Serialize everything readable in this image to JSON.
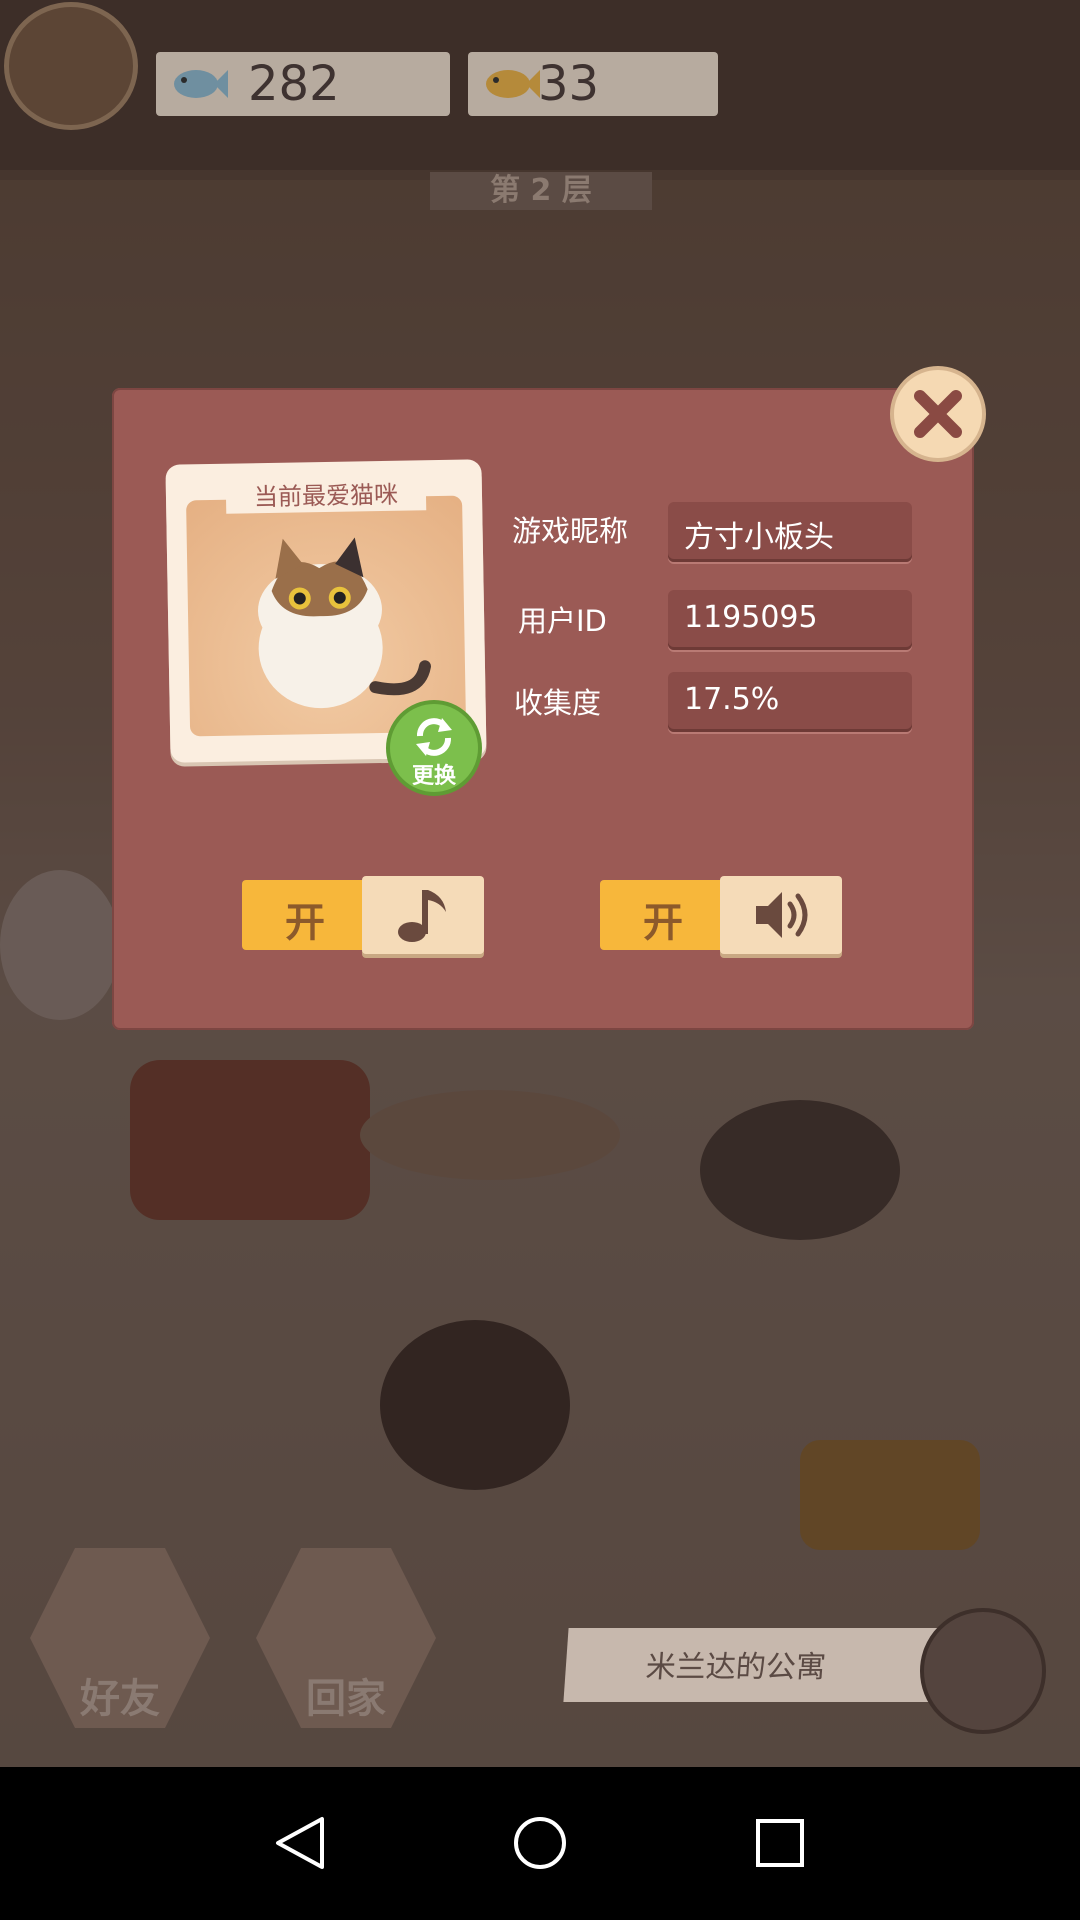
{
  "top_bar": {
    "fish_blue_count": "282",
    "fish_gold_count": "33",
    "floor_label": "第 2 层"
  },
  "profile_dialog": {
    "card_title": "当前最爱猫咪",
    "swap_label": "更换",
    "fields": [
      {
        "label": "游戏昵称",
        "value": "方寸小板头"
      },
      {
        "label": "用户ID",
        "value": "1195095"
      },
      {
        "label": "收集度",
        "value": "17.5%"
      }
    ],
    "music_toggle": {
      "state_label": "开",
      "icon": "music-note-icon"
    },
    "sound_toggle": {
      "state_label": "开",
      "icon": "speaker-icon"
    }
  },
  "bottom_bar": {
    "friends_label": "好友",
    "home_label": "回家",
    "apartment_label": "米兰达的公寓"
  },
  "colors": {
    "dialog_bg": "#9b5a55",
    "toggle_on": "#f7b73b",
    "swap_green": "#7cbf4c"
  }
}
